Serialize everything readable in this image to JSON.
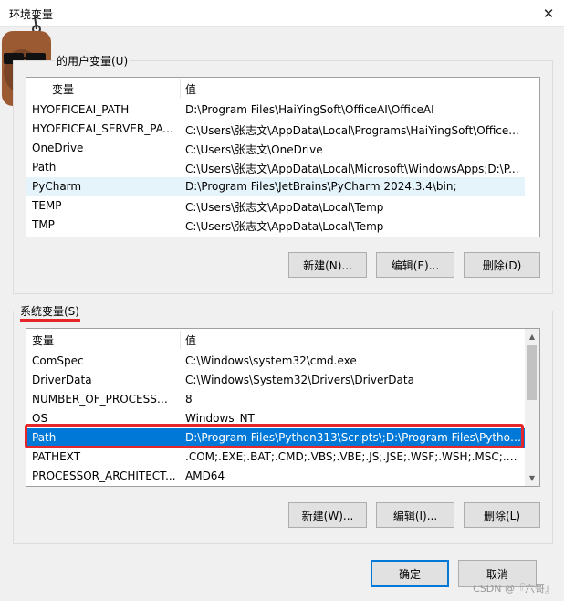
{
  "window": {
    "title": "环境变量",
    "close_icon": "✕"
  },
  "user_vars": {
    "group_label": "的用户变量(U)",
    "col_var": "变量",
    "col_val": "值",
    "rows": [
      {
        "name": "HYOFFICEAI_PATH",
        "value": "D:\\Program Files\\HaiYingSoft\\OfficeAI\\OfficeAI"
      },
      {
        "name": "HYOFFICEAI_SERVER_PATH",
        "value": "C:\\Users\\张志文\\AppData\\Local\\Programs\\HaiYingSoft\\Office..."
      },
      {
        "name": "OneDrive",
        "value": "C:\\Users\\张志文\\OneDrive"
      },
      {
        "name": "Path",
        "value": "C:\\Users\\张志文\\AppData\\Local\\Microsoft\\WindowsApps;D:\\P..."
      },
      {
        "name": "PyCharm",
        "value": "D:\\Program Files\\JetBrains\\PyCharm 2024.3.4\\bin;"
      },
      {
        "name": "TEMP",
        "value": "C:\\Users\\张志文\\AppData\\Local\\Temp"
      },
      {
        "name": "TMP",
        "value": "C:\\Users\\张志文\\AppData\\Local\\Temp"
      }
    ],
    "new_button": "新建(N)...",
    "edit_button": "编辑(E)...",
    "delete_button": "删除(D)"
  },
  "system_vars": {
    "group_label": "系统变量(S)",
    "col_var": "变量",
    "col_val": "值",
    "rows": [
      {
        "name": "ComSpec",
        "value": "C:\\Windows\\system32\\cmd.exe"
      },
      {
        "name": "DriverData",
        "value": "C:\\Windows\\System32\\Drivers\\DriverData"
      },
      {
        "name": "NUMBER_OF_PROCESSORS",
        "value": "8"
      },
      {
        "name": "OS",
        "value": "Windows_NT"
      },
      {
        "name": "Path",
        "value": "D:\\Program Files\\Python313\\Scripts\\;D:\\Program Files\\Python..."
      },
      {
        "name": "PATHEXT",
        "value": ".COM;.EXE;.BAT;.CMD;.VBS;.VBE;.JS;.JSE;.WSF;.WSH;.MSC;.PY;.P..."
      },
      {
        "name": "PROCESSOR_ARCHITECT...",
        "value": "AMD64"
      }
    ],
    "new_button": "新建(W)...",
    "edit_button": "编辑(I)...",
    "delete_button": "删除(L)"
  },
  "footer": {
    "ok_button": "确定",
    "cancel_button": "取消",
    "watermark": "CSDN @『六哥』"
  },
  "colors": {
    "selection": "#0078d7",
    "highlight_box": "#e5262b",
    "hover_row": "#e5f3fb"
  }
}
